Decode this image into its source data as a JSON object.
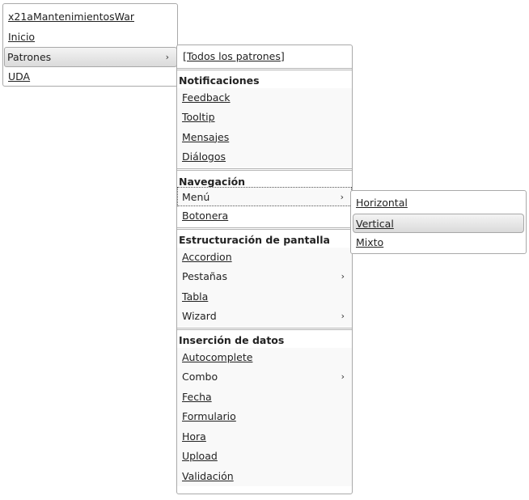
{
  "root_menu": {
    "items": [
      {
        "label": "x21aMantenimientosWar"
      },
      {
        "label": "Inicio"
      },
      {
        "label": "Patrones",
        "arrow": "›"
      },
      {
        "label": "UDA"
      }
    ]
  },
  "patrones_menu": {
    "all_label": "[Todos los patrones]",
    "notificaciones": {
      "title": "Notificaciones",
      "items": [
        "Feedback",
        "Tooltip",
        "Mensajes",
        "Diálogos"
      ]
    },
    "navegacion": {
      "title": "Navegación",
      "menu_label": "Menú",
      "menu_arrow": "›",
      "botonera_label": "Botonera"
    },
    "estructuracion": {
      "title": "Estructuración de pantalla",
      "accordion": "Accordion",
      "pestanas": "Pestañas",
      "pestanas_arrow": "›",
      "tabla": "Tabla",
      "wizard": "Wizard",
      "wizard_arrow": "›"
    },
    "insercion": {
      "title": "Inserción de datos",
      "autocomplete": "Autocomplete",
      "combo": "Combo",
      "combo_arrow": "›",
      "fecha": "Fecha",
      "formulario": "Formulario",
      "hora": "Hora",
      "upload": "Upload",
      "validacion": "Validación"
    }
  },
  "menu_submenu": {
    "items": [
      "Horizontal",
      "Vertical",
      "Mixto"
    ]
  }
}
